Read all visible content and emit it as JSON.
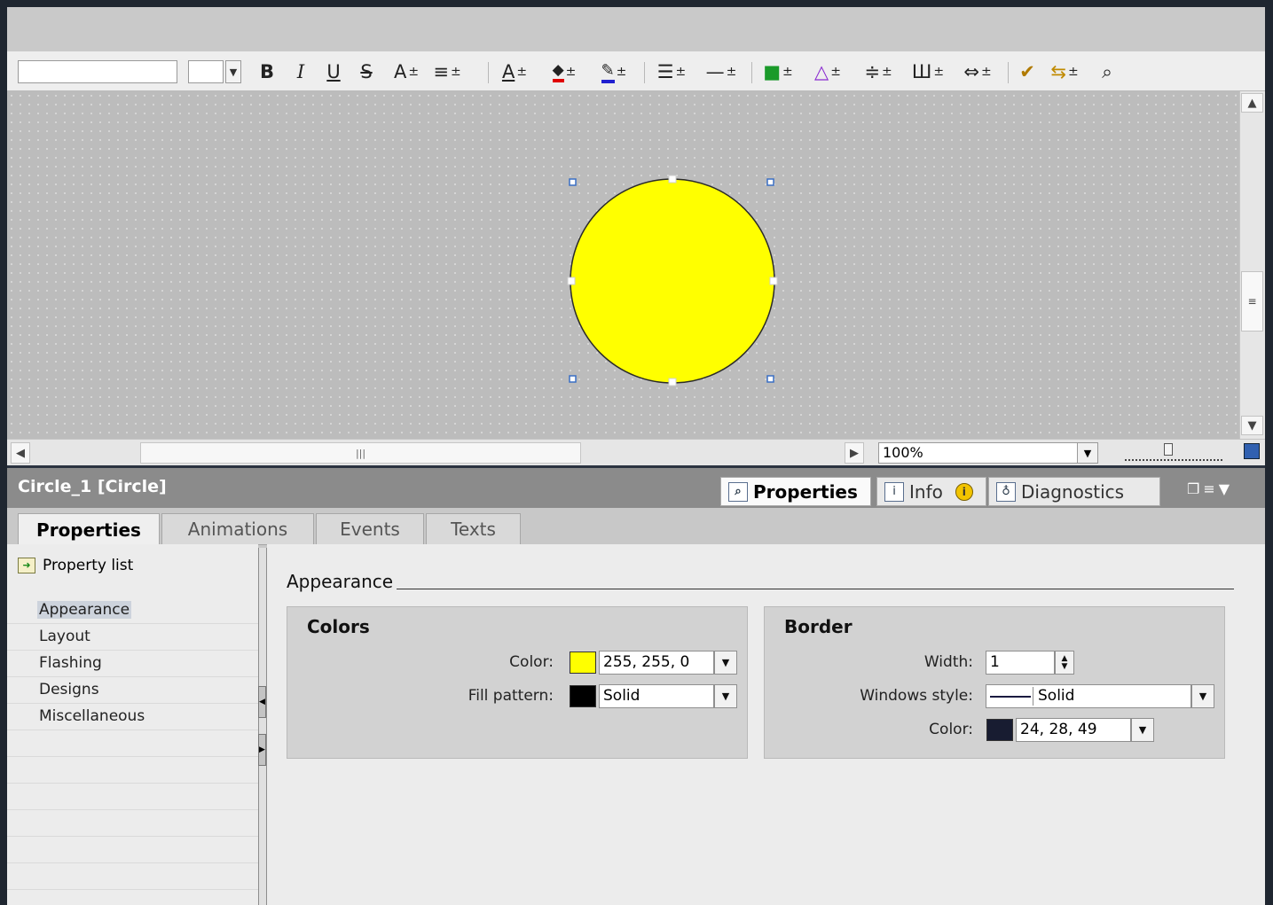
{
  "toolbar": {
    "font_name": "",
    "font_size": "",
    "items": [
      {
        "glyph": "B",
        "name": "bold-button"
      },
      {
        "glyph": "I",
        "name": "italic-button"
      },
      {
        "glyph": "U",
        "name": "underline-button"
      },
      {
        "glyph": "S",
        "name": "strikethrough-button"
      },
      {
        "glyph": "A",
        "name": "font-size-increase-button"
      },
      {
        "glyph": "≡",
        "name": "text-align-button"
      },
      {
        "glyph": "A",
        "name": "font-color-button"
      },
      {
        "glyph": "◆",
        "name": "fill-color-button"
      },
      {
        "glyph": "✎",
        "name": "line-color-button"
      },
      {
        "glyph": "☰",
        "name": "line-width-button"
      },
      {
        "glyph": "—",
        "name": "line-style-button"
      },
      {
        "glyph": "■",
        "name": "object-position-button"
      },
      {
        "glyph": "△",
        "name": "rotate-button"
      },
      {
        "glyph": "≑",
        "name": "align-button"
      },
      {
        "glyph": "Ш",
        "name": "distribute-button"
      },
      {
        "glyph": "⇔",
        "name": "same-size-button"
      },
      {
        "glyph": "✔",
        "name": "format-painter-button"
      },
      {
        "glyph": "⇆",
        "name": "layer-button"
      },
      {
        "glyph": "⌕",
        "name": "zoom-selection-button"
      }
    ]
  },
  "zoom": {
    "value": "100%"
  },
  "object_title": "Circle_1 [Circle]",
  "inspector_tabs": {
    "properties": "Properties",
    "info": "Info",
    "diagnostics": "Diagnostics"
  },
  "subtabs": [
    "Properties",
    "Animations",
    "Events",
    "Texts"
  ],
  "property_list": {
    "header": "Property list",
    "items": [
      "Appearance",
      "Layout",
      "Flashing",
      "Designs",
      "Miscellaneous"
    ],
    "selected": "Appearance"
  },
  "appearance": {
    "title": "Appearance",
    "colors": {
      "title": "Colors",
      "color_label": "Color:",
      "color_value": "255, 255, 0",
      "color_swatch": "#ffff00",
      "fill_pattern_label": "Fill pattern:",
      "fill_pattern_value": "Solid",
      "fill_swatch": "#000000"
    },
    "border": {
      "title": "Border",
      "width_label": "Width:",
      "width_value": "1",
      "style_label": "Windows style:",
      "style_value": "Solid",
      "color_label": "Color:",
      "color_value": "24, 28, 49",
      "color_swatch": "#181c31"
    }
  },
  "canvas_object": {
    "fill": "#ffff00",
    "border": "#2a2a2a"
  },
  "colors": {
    "accent": "#3a6fc4",
    "header_bg": "#8b8b8b"
  }
}
